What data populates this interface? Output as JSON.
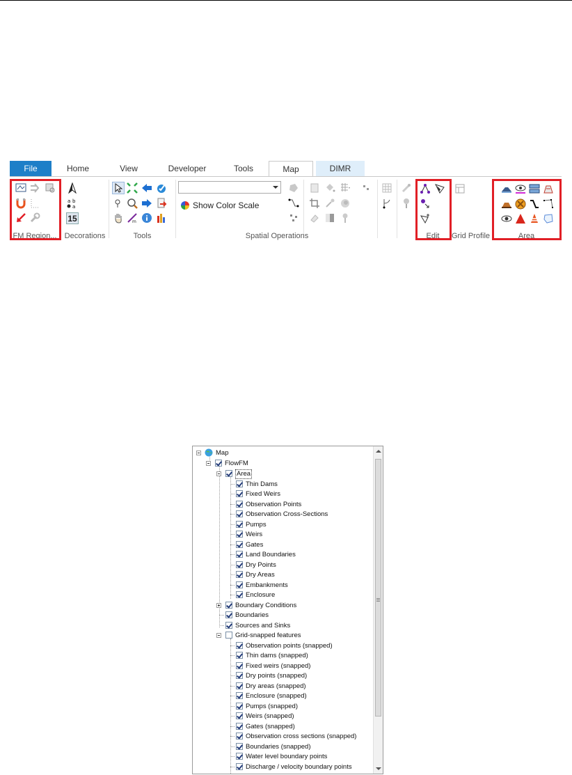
{
  "ribbon": {
    "tabs": [
      {
        "label": "File"
      },
      {
        "label": "Home"
      },
      {
        "label": "View"
      },
      {
        "label": "Developer"
      },
      {
        "label": "Tools"
      },
      {
        "label": "Map",
        "active": true
      },
      {
        "label": "DIMR"
      }
    ],
    "groups": {
      "fm_region": "FM Region...",
      "decorations": "Decorations",
      "tools": "Tools",
      "spatial_operations": "Spatial Operations",
      "edit": "Edit",
      "grid_profile": "Grid Profile",
      "area": "Area"
    },
    "show_color_scale": "Show Color Scale",
    "decorations_date": "15",
    "colors": {
      "file_tab": "#1e7fc8",
      "dimr_tab": "#dfeefa",
      "highlight": "#e11f26"
    }
  },
  "tree": {
    "root": "Map",
    "flowfm": "FlowFM",
    "area": {
      "label": "Area",
      "children": [
        "Thin Dams",
        "Fixed Weirs",
        "Observation Points",
        "Observation Cross-Sections",
        "Pumps",
        "Weirs",
        "Gates",
        "Land Boundaries",
        "Dry Points",
        "Dry Areas",
        "Embankments",
        "Enclosure"
      ]
    },
    "boundary_conditions": "Boundary Conditions",
    "boundaries": "Boundaries",
    "sources_sinks": "Sources and Sinks",
    "grid_snapped": {
      "label": "Grid-snapped features",
      "children": [
        "Observation points (snapped)",
        "Thin dams (snapped)",
        "Fixed weirs (snapped)",
        "Dry points (snapped)",
        "Dry areas (snapped)",
        "Enclosure (snapped)",
        "Pumps (snapped)",
        "Weirs (snapped)",
        "Gates (snapped)",
        "Observation cross sections (snapped)",
        "Boundaries (snapped)",
        "Water level boundary points",
        "Discharge / velocity boundary points"
      ]
    }
  }
}
